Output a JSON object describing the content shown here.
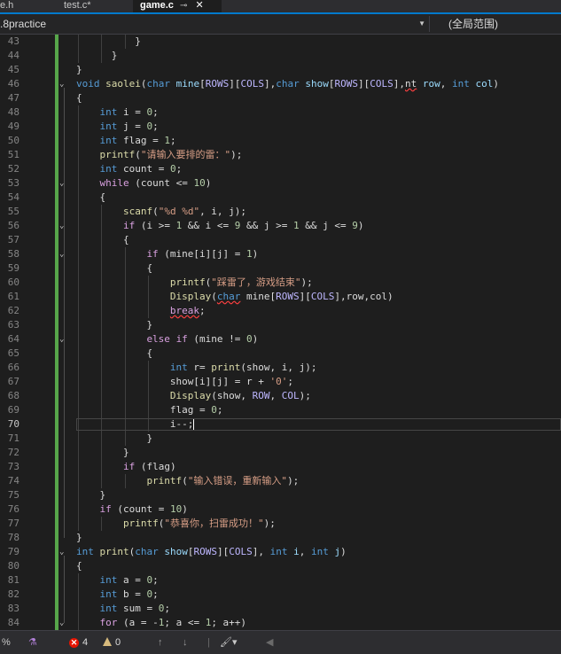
{
  "tabs": [
    {
      "label": "e.h"
    },
    {
      "label": "test.c*"
    },
    {
      "label": "game.c",
      "pin": "⊸",
      "close": "✕"
    }
  ],
  "navbar": {
    "project": ".8practice",
    "scope": "(全局范围)"
  },
  "editor": {
    "current_line": 70,
    "lines": [
      {
        "n": 43,
        "indent": 5,
        "toks": [
          [
            "}",
            ""
          ]
        ]
      },
      {
        "n": 44,
        "indent": 3,
        "toks": [
          [
            "}",
            ""
          ]
        ]
      },
      {
        "n": 45,
        "indent": 0,
        "toks": [
          [
            "}",
            ""
          ]
        ]
      },
      {
        "n": 46,
        "indent": 0,
        "fold": true,
        "toks": [
          [
            "void",
            "kw"
          ],
          [
            " ",
            ""
          ],
          [
            "saolei",
            "fn"
          ],
          [
            "(",
            ""
          ],
          [
            "char",
            "kw"
          ],
          [
            " ",
            ""
          ],
          [
            "mine",
            "par"
          ],
          [
            "[",
            ""
          ],
          [
            "ROWS",
            "mac"
          ],
          [
            "][",
            ""
          ],
          [
            "COLS",
            "mac"
          ],
          [
            "],",
            ""
          ],
          [
            "char",
            "kw"
          ],
          [
            " ",
            ""
          ],
          [
            "show",
            "par"
          ],
          [
            "[",
            ""
          ],
          [
            "ROWS",
            "mac"
          ],
          [
            "][",
            ""
          ],
          [
            "COLS",
            "mac"
          ],
          [
            "],",
            ""
          ],
          [
            "nt",
            "err"
          ],
          [
            " ",
            ""
          ],
          [
            "row",
            "par"
          ],
          [
            ", ",
            ""
          ],
          [
            "int",
            "kw"
          ],
          [
            " ",
            ""
          ],
          [
            "col",
            "par"
          ],
          [
            ")",
            ""
          ]
        ]
      },
      {
        "n": 47,
        "indent": 0,
        "toks": [
          [
            "{",
            ""
          ]
        ]
      },
      {
        "n": 48,
        "indent": 2,
        "toks": [
          [
            "int",
            "kw"
          ],
          [
            " i = ",
            ""
          ],
          [
            "0",
            "num"
          ],
          [
            ";",
            ""
          ]
        ]
      },
      {
        "n": 49,
        "indent": 2,
        "toks": [
          [
            "int",
            "kw"
          ],
          [
            " j = ",
            ""
          ],
          [
            "0",
            "num"
          ],
          [
            ";",
            ""
          ]
        ]
      },
      {
        "n": 50,
        "indent": 2,
        "toks": [
          [
            "int",
            "kw"
          ],
          [
            " flag = ",
            ""
          ],
          [
            "1",
            "num"
          ],
          [
            ";",
            ""
          ]
        ]
      },
      {
        "n": 51,
        "indent": 2,
        "toks": [
          [
            "printf",
            "fn"
          ],
          [
            "(",
            ""
          ],
          [
            "\"请输入要排的雷：\"",
            "str"
          ],
          [
            ");",
            ""
          ]
        ]
      },
      {
        "n": 52,
        "indent": 2,
        "toks": [
          [
            "int",
            "kw"
          ],
          [
            " count = ",
            ""
          ],
          [
            "0",
            "num"
          ],
          [
            ";",
            ""
          ]
        ]
      },
      {
        "n": 53,
        "indent": 2,
        "fold": true,
        "toks": [
          [
            "while",
            "ctl"
          ],
          [
            " (count <= ",
            ""
          ],
          [
            "10",
            "num"
          ],
          [
            ")",
            ""
          ]
        ]
      },
      {
        "n": 54,
        "indent": 2,
        "toks": [
          [
            "{",
            ""
          ]
        ]
      },
      {
        "n": 55,
        "indent": 4,
        "toks": [
          [
            "scanf",
            "fn"
          ],
          [
            "(",
            ""
          ],
          [
            "\"%d %d\"",
            "str"
          ],
          [
            ", i, j);",
            ""
          ]
        ]
      },
      {
        "n": 56,
        "indent": 4,
        "fold": true,
        "toks": [
          [
            "if",
            "ctl"
          ],
          [
            " (i >= ",
            ""
          ],
          [
            "1",
            "num"
          ],
          [
            " && i <= ",
            ""
          ],
          [
            "9",
            "num"
          ],
          [
            " && j >= ",
            ""
          ],
          [
            "1",
            "num"
          ],
          [
            " && j <= ",
            ""
          ],
          [
            "9",
            "num"
          ],
          [
            ")",
            ""
          ]
        ]
      },
      {
        "n": 57,
        "indent": 4,
        "toks": [
          [
            "{",
            ""
          ]
        ]
      },
      {
        "n": 58,
        "indent": 6,
        "fold": true,
        "toks": [
          [
            "if",
            "ctl"
          ],
          [
            " (mine[i][j] = ",
            ""
          ],
          [
            "1",
            "num"
          ],
          [
            ")",
            ""
          ]
        ]
      },
      {
        "n": 59,
        "indent": 6,
        "toks": [
          [
            "{",
            ""
          ]
        ]
      },
      {
        "n": 60,
        "indent": 8,
        "toks": [
          [
            "printf",
            "fn"
          ],
          [
            "(",
            ""
          ],
          [
            "\"踩雷了，游戏结束\"",
            "str"
          ],
          [
            ");",
            ""
          ]
        ]
      },
      {
        "n": 61,
        "indent": 8,
        "toks": [
          [
            "Display",
            "fn"
          ],
          [
            "(",
            ""
          ],
          [
            "char",
            "kw err"
          ],
          [
            " mine[",
            ""
          ],
          [
            "ROWS",
            "mac"
          ],
          [
            "][",
            ""
          ],
          [
            "COLS",
            "mac"
          ],
          [
            "],row,col)",
            ""
          ]
        ]
      },
      {
        "n": 62,
        "indent": 8,
        "toks": [
          [
            "break",
            "ctl err"
          ],
          [
            ";",
            ""
          ]
        ]
      },
      {
        "n": 63,
        "indent": 6,
        "toks": [
          [
            "}",
            ""
          ]
        ]
      },
      {
        "n": 64,
        "indent": 6,
        "fold": true,
        "toks": [
          [
            "else",
            "ctl"
          ],
          [
            " ",
            ""
          ],
          [
            "if",
            "ctl"
          ],
          [
            " (mine != ",
            ""
          ],
          [
            "0",
            "num"
          ],
          [
            ")",
            ""
          ]
        ]
      },
      {
        "n": 65,
        "indent": 6,
        "toks": [
          [
            "{",
            ""
          ]
        ]
      },
      {
        "n": 66,
        "indent": 8,
        "toks": [
          [
            "int",
            "kw"
          ],
          [
            " r= ",
            ""
          ],
          [
            "print",
            "fn"
          ],
          [
            "(show, i, j);",
            ""
          ]
        ]
      },
      {
        "n": 67,
        "indent": 8,
        "toks": [
          [
            "show[i][j] = r + ",
            ""
          ],
          [
            "'0'",
            "str"
          ],
          [
            ";",
            ""
          ]
        ]
      },
      {
        "n": 68,
        "indent": 8,
        "toks": [
          [
            "Display",
            "fn"
          ],
          [
            "(show, ",
            ""
          ],
          [
            "ROW",
            "mac"
          ],
          [
            ", ",
            ""
          ],
          [
            "COL",
            "mac"
          ],
          [
            ");",
            ""
          ]
        ]
      },
      {
        "n": 69,
        "indent": 8,
        "toks": [
          [
            "flag = ",
            ""
          ],
          [
            "0",
            "num"
          ],
          [
            ";",
            ""
          ]
        ]
      },
      {
        "n": 70,
        "indent": 8,
        "caret": true,
        "toks": [
          [
            "i--;",
            ""
          ]
        ]
      },
      {
        "n": 71,
        "indent": 6,
        "toks": [
          [
            "}",
            ""
          ]
        ]
      },
      {
        "n": 72,
        "indent": 4,
        "toks": [
          [
            "}",
            ""
          ]
        ]
      },
      {
        "n": 73,
        "indent": 4,
        "toks": [
          [
            "if",
            "ctl"
          ],
          [
            " (flag)",
            ""
          ]
        ]
      },
      {
        "n": 74,
        "indent": 6,
        "toks": [
          [
            "printf",
            "fn"
          ],
          [
            "(",
            ""
          ],
          [
            "\"输入错误，重新输入\"",
            "str"
          ],
          [
            ");",
            ""
          ]
        ]
      },
      {
        "n": 75,
        "indent": 2,
        "toks": [
          [
            "}",
            ""
          ]
        ]
      },
      {
        "n": 76,
        "indent": 2,
        "toks": [
          [
            "if",
            "ctl"
          ],
          [
            " (count = ",
            ""
          ],
          [
            "10",
            "num"
          ],
          [
            ")",
            ""
          ]
        ]
      },
      {
        "n": 77,
        "indent": 4,
        "toks": [
          [
            "printf",
            "fn"
          ],
          [
            "(",
            ""
          ],
          [
            "\"恭喜你，扫雷成功！\"",
            "str"
          ],
          [
            ");",
            ""
          ]
        ]
      },
      {
        "n": 78,
        "indent": 0,
        "toks": [
          [
            "}",
            ""
          ]
        ]
      },
      {
        "n": 79,
        "indent": 0,
        "fold": true,
        "toks": [
          [
            "int",
            "kw"
          ],
          [
            " ",
            ""
          ],
          [
            "print",
            "fn"
          ],
          [
            "(",
            ""
          ],
          [
            "char",
            "kw"
          ],
          [
            " ",
            ""
          ],
          [
            "show",
            "par"
          ],
          [
            "[",
            ""
          ],
          [
            "ROWS",
            "mac"
          ],
          [
            "][",
            ""
          ],
          [
            "COLS",
            "mac"
          ],
          [
            "], ",
            ""
          ],
          [
            "int",
            "kw"
          ],
          [
            " ",
            ""
          ],
          [
            "i",
            "par"
          ],
          [
            ", ",
            ""
          ],
          [
            "int",
            "kw"
          ],
          [
            " ",
            ""
          ],
          [
            "j",
            "par"
          ],
          [
            ")",
            ""
          ]
        ]
      },
      {
        "n": 80,
        "indent": 0,
        "toks": [
          [
            "{",
            ""
          ]
        ]
      },
      {
        "n": 81,
        "indent": 2,
        "toks": [
          [
            "int",
            "kw"
          ],
          [
            " a = ",
            ""
          ],
          [
            "0",
            "num"
          ],
          [
            ";",
            ""
          ]
        ]
      },
      {
        "n": 82,
        "indent": 2,
        "toks": [
          [
            "int",
            "kw"
          ],
          [
            " b = ",
            ""
          ],
          [
            "0",
            "num"
          ],
          [
            ";",
            ""
          ]
        ]
      },
      {
        "n": 83,
        "indent": 2,
        "toks": [
          [
            "int",
            "kw"
          ],
          [
            " sum = ",
            ""
          ],
          [
            "0",
            "num"
          ],
          [
            ";",
            ""
          ]
        ]
      },
      {
        "n": 84,
        "indent": 2,
        "fold": true,
        "toks": [
          [
            "for",
            "ctl"
          ],
          [
            " (a = -",
            ""
          ],
          [
            "1",
            "num"
          ],
          [
            "; a <= ",
            ""
          ],
          [
            "1",
            "num"
          ],
          [
            "; a++)",
            ""
          ]
        ]
      }
    ]
  },
  "status": {
    "zoom": "%",
    "errors": "4",
    "warnings": "0",
    "colors": {
      "error": "#e51400",
      "warning": "#d7ba7d",
      "accent": "#007acc"
    }
  }
}
